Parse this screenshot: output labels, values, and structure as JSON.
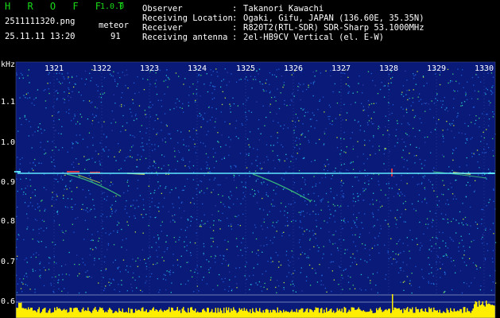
{
  "header": {
    "app_title": "H R O F F T",
    "app_version": "1.0.0",
    "file_name": "2511111320.png",
    "datetime": "25.11.11 13:20",
    "meteor_label": "meteor",
    "meteor_count": "91"
  },
  "info": [
    {
      "label": "Observer",
      "colon": ":",
      "value": "Takanori Kawachi"
    },
    {
      "label": "Receiving Location",
      "colon": ":",
      "value": "Ogaki, Gifu, JAPAN (136.60E, 35.35N)"
    },
    {
      "label": "Receiver",
      "colon": ":",
      "value": "R820T2(RTL-SDR) SDR-Sharp 53.1000MHz"
    },
    {
      "label": "Receiving antenna",
      "colon": ":",
      "value": "2el-HB9CV Vertical (el. E-W)"
    }
  ],
  "axes": {
    "y_unit": "kHz",
    "y_ticks": [
      "1.1",
      "1.0",
      "0.9",
      "0.8",
      "0.7",
      "0.6"
    ],
    "x_ticks": [
      "1321",
      "1322",
      "1323",
      "1324",
      "1325",
      "1326",
      "1327",
      "1328",
      "1329",
      "1330"
    ]
  },
  "colors": {
    "background": "#000000",
    "plot_background": "#0a1a78",
    "title_green": "#19d919",
    "carrier": "#5ee8ff",
    "noise_histogram": "#ffee00"
  }
}
